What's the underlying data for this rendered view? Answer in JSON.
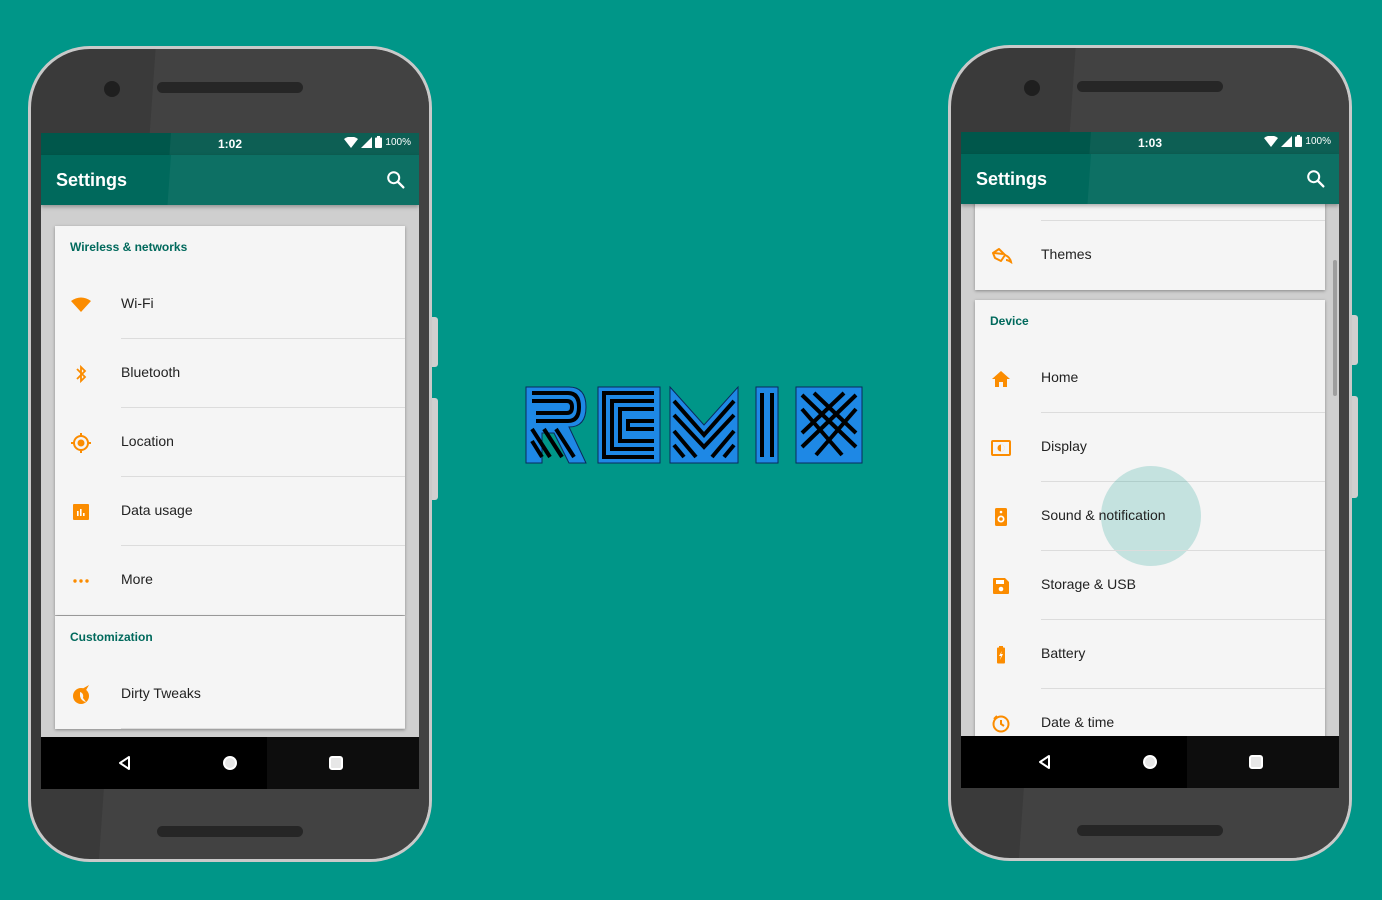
{
  "colors": {
    "background": "#009688",
    "accent": "#FB8C00",
    "primary": "#00695C",
    "primary_dark": "#00574B",
    "logo_fill": "#1E88E5"
  },
  "logo": {
    "text": "REMIX"
  },
  "phones": [
    {
      "status": {
        "time": "1:02",
        "battery": "100%"
      },
      "appbar": {
        "title": "Settings",
        "search_icon": "search-icon"
      },
      "sections": [
        {
          "header": "Wireless & networks",
          "items": [
            {
              "label": "Wi-Fi",
              "icon": "wifi-icon"
            },
            {
              "label": "Bluetooth",
              "icon": "bluetooth-icon"
            },
            {
              "label": "Location",
              "icon": "location-icon"
            },
            {
              "label": "Data usage",
              "icon": "data-usage-icon"
            },
            {
              "label": "More",
              "icon": "more-icon"
            }
          ]
        },
        {
          "header": "Customization",
          "items": [
            {
              "label": "Dirty Tweaks",
              "icon": "unicorn-icon"
            }
          ]
        }
      ],
      "nav": {
        "back": "back-icon",
        "home": "home-nav-icon",
        "recents": "recents-icon"
      }
    },
    {
      "status": {
        "time": "1:03",
        "battery": "100%"
      },
      "appbar": {
        "title": "Settings",
        "search_icon": "search-icon"
      },
      "sections": [
        {
          "header": "",
          "items": [
            {
              "label": "Themes",
              "icon": "themes-icon"
            }
          ]
        },
        {
          "header": "Device",
          "items": [
            {
              "label": "Home",
              "icon": "home-icon"
            },
            {
              "label": "Display",
              "icon": "display-icon"
            },
            {
              "label": "Sound & notification",
              "icon": "speaker-icon"
            },
            {
              "label": "Storage & USB",
              "icon": "storage-icon"
            },
            {
              "label": "Battery",
              "icon": "battery-icon"
            },
            {
              "label": "Date & time",
              "icon": "clock-icon"
            }
          ]
        }
      ],
      "nav": {
        "back": "back-icon",
        "home": "home-nav-icon",
        "recents": "recents-icon"
      }
    }
  ]
}
